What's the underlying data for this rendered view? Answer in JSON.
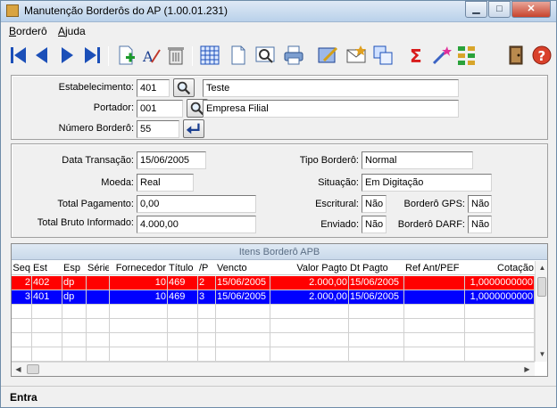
{
  "window": {
    "title": "Manutenção Borderôs do AP (1.00.01.231)"
  },
  "window_buttons": {
    "minimize": "▁",
    "maximize": "□",
    "close": "✕"
  },
  "menu": [
    {
      "label": "Borderô",
      "accel": "B",
      "rest": "orderô"
    },
    {
      "label": "Ajuda",
      "accel": "A",
      "rest": "juda"
    }
  ],
  "toolbar_icons": [
    "first-icon",
    "previous-icon",
    "next-icon",
    "last-icon",
    "new-icon",
    "edit-icon",
    "delete-icon",
    "calendar-icon",
    "document-icon",
    "preview-icon",
    "print-icon",
    "approve-icon",
    "mail-icon",
    "copy-icon",
    "sum-icon",
    "wand-icon",
    "grid-options-icon",
    "exit-icon",
    "help-icon"
  ],
  "header": {
    "estabelecimento": {
      "label": "Estabelecimento:",
      "value": "401",
      "desc": "Teste"
    },
    "portador": {
      "label": "Portador:",
      "value": "001",
      "desc": "Empresa Filial"
    },
    "numero_bordero": {
      "label": "Número Borderô:",
      "value": "55"
    }
  },
  "details": {
    "data_transacao": {
      "label": "Data Transação:",
      "value": "15/06/2005"
    },
    "moeda": {
      "label": "Moeda:",
      "value": "Real"
    },
    "total_pagamento": {
      "label": "Total Pagamento:",
      "value": "0,00"
    },
    "total_bruto": {
      "label": "Total Bruto Informado:",
      "value": "4.000,00"
    },
    "tipo_bordero": {
      "label": "Tipo Borderô:",
      "value": "Normal"
    },
    "situacao": {
      "label": "Situação:",
      "value": "Em Digitação"
    },
    "escritural": {
      "label": "Escritural:",
      "value": "Não"
    },
    "enviado": {
      "label": "Enviado:",
      "value": "Não"
    },
    "bordero_gps": {
      "label": "Borderô GPS:",
      "value": "Não"
    },
    "bordero_darf": {
      "label": "Borderô DARF:",
      "value": "Não"
    }
  },
  "grid": {
    "title": "Itens Borderô APB",
    "columns": [
      "Seq",
      "Est",
      "Esp",
      "Série",
      "Fornecedor",
      "Título",
      "/P",
      "Vencto",
      "Valor Pagto",
      "Dt Pagto",
      "Ref Ant/PEF",
      "Cotação"
    ],
    "rows": [
      {
        "cells": [
          "2",
          "402",
          "dp",
          "",
          "10",
          "469",
          "2",
          "15/06/2005",
          "2.000,00",
          "15/06/2005",
          "",
          "1,0000000000"
        ],
        "color": "#ff0000"
      },
      {
        "cells": [
          "3",
          "401",
          "dp",
          "",
          "10",
          "469",
          "3",
          "15/06/2005",
          "2.000,00",
          "15/06/2005",
          "",
          "1,0000000000"
        ],
        "color": "#0000ff"
      }
    ]
  },
  "status": {
    "text": "Entra"
  }
}
